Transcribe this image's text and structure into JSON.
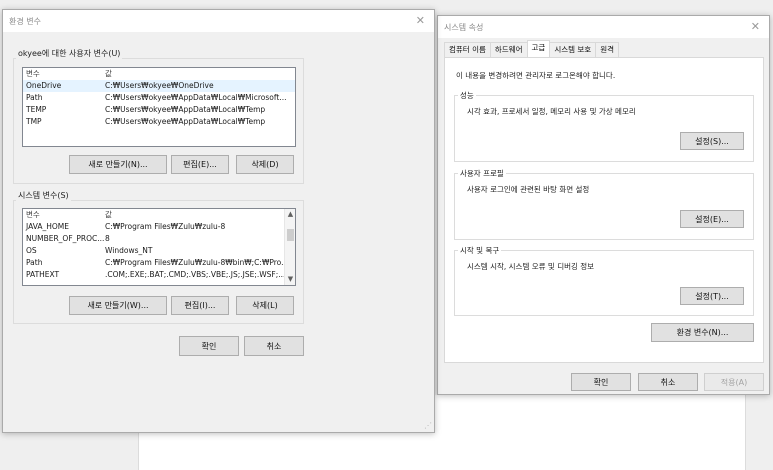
{
  "env_window": {
    "title": "환경 변수",
    "user_vars": {
      "group_label": "okyee에 대한 사용자 변수(U)",
      "col_var": "변수",
      "col_value": "값",
      "rows": [
        {
          "name": "OneDrive",
          "value": "C:₩Users₩okyee₩OneDrive"
        },
        {
          "name": "Path",
          "value": "C:₩Users₩okyee₩AppData₩Local₩Microsoft..."
        },
        {
          "name": "TEMP",
          "value": "C:₩Users₩okyee₩AppData₩Local₩Temp"
        },
        {
          "name": "TMP",
          "value": "C:₩Users₩okyee₩AppData₩Local₩Temp"
        }
      ],
      "new_label": "새로 만들기(N)...",
      "edit_label": "편집(E)...",
      "delete_label": "삭제(D)"
    },
    "system_vars": {
      "group_label": "시스템 변수(S)",
      "col_var": "변수",
      "col_value": "값",
      "rows": [
        {
          "name": "JAVA_HOME",
          "value": "C:₩Program Files₩Zulu₩zulu-8"
        },
        {
          "name": "NUMBER_OF_PROC...",
          "value": "8"
        },
        {
          "name": "OS",
          "value": "Windows_NT"
        },
        {
          "name": "Path",
          "value": "C:₩Program Files₩Zulu₩zulu-8₩bin₩;C:₩Pro..."
        },
        {
          "name": "PATHEXT",
          "value": ".COM;.EXE;.BAT;.CMD;.VBS;.VBE;.JS;.JSE;.WSF;..."
        }
      ],
      "new_label": "새로 만들기(W)...",
      "edit_label": "편집(I)...",
      "delete_label": "삭제(L)"
    },
    "ok_label": "확인",
    "cancel_label": "취소"
  },
  "sys_window": {
    "title": "시스템 속성",
    "tabs": [
      "컴퓨터 이름",
      "하드웨어",
      "고급",
      "시스템 보호",
      "원격"
    ],
    "note": "이 내용을 변경하려면 관리자로 로그온해야 합니다.",
    "performance": {
      "label": "성능",
      "desc": "시각 효과, 프로세서 일정, 메모리 사용 및 가상 메모리",
      "button": "설정(S)..."
    },
    "profile": {
      "label": "사용자 프로필",
      "desc": "사용자 로그인에 관련된 바탕 화면 설정",
      "button": "설정(E)..."
    },
    "startup": {
      "label": "시작 및 복구",
      "desc": "시스템 시작, 시스템 오류 및 디버깅 정보",
      "button": "설정(T)..."
    },
    "env_button": "환경 변수(N)...",
    "ok_label": "확인",
    "cancel_label": "취소",
    "apply_label": "적용(A)"
  }
}
